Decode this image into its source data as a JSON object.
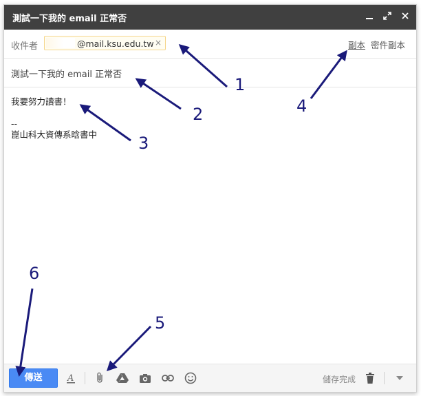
{
  "window": {
    "title": "測試一下我的 email 正常否",
    "controls": [
      "minimize-icon",
      "expand-icon",
      "close-icon"
    ]
  },
  "recipients": {
    "label": "收件者",
    "chip_text": "@mail.ksu.edu.tw",
    "chip_remove": "×",
    "cc_label": "副本",
    "bcc_label": "密件副本"
  },
  "subject": {
    "value": "測試一下我的 email 正常否"
  },
  "body": {
    "lines": [
      "我要努力讀書！",
      "",
      "--",
      "崑山科大資傳系晗書中"
    ]
  },
  "toolbar": {
    "send_label": "傳送",
    "tools": [
      "format-text-icon",
      "attach-icon",
      "drive-icon",
      "camera-icon",
      "link-icon",
      "emoji-icon"
    ],
    "status": "儲存完成",
    "more": "chevron-down-icon",
    "accent_color": "#4a8af4",
    "titlebar_color": "#404040"
  },
  "annotations": {
    "labels": [
      "1",
      "2",
      "3",
      "4",
      "5",
      "6"
    ],
    "arrow_color": "#1a1a7a"
  }
}
